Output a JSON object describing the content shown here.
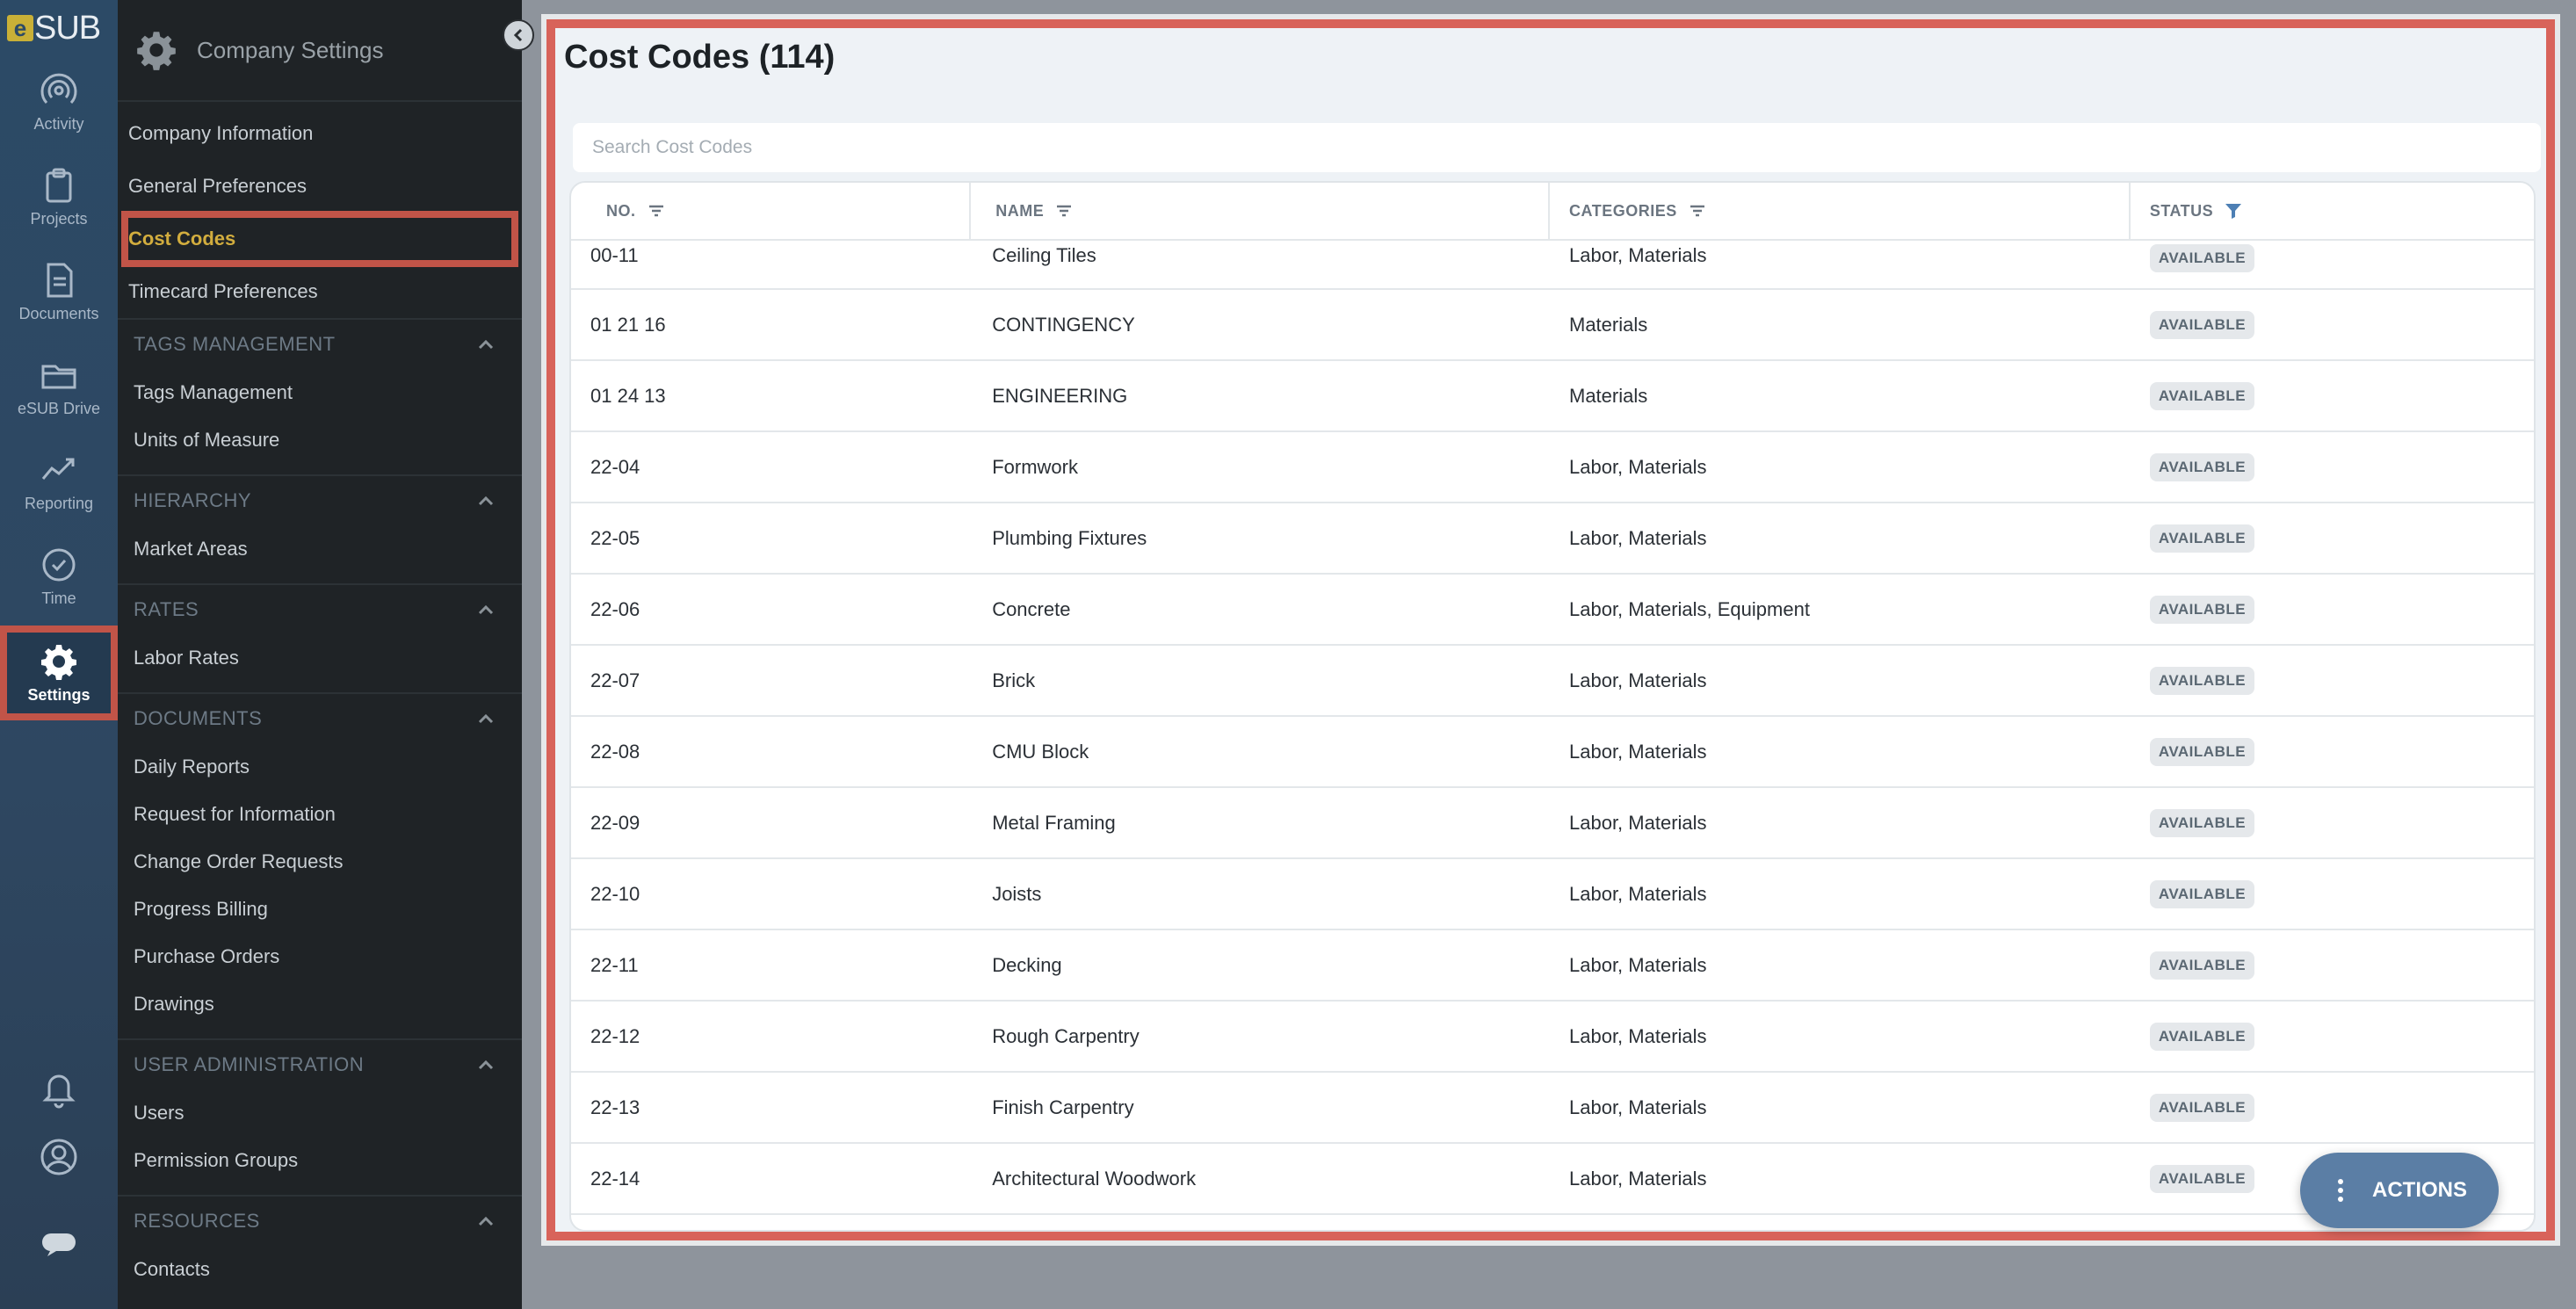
{
  "rail": {
    "logo_letter": "e",
    "logo_text": "SUB",
    "items": [
      {
        "label": "Activity",
        "icon": "activity-icon"
      },
      {
        "label": "Projects",
        "icon": "clipboard-icon"
      },
      {
        "label": "Documents",
        "icon": "document-icon"
      },
      {
        "label": "eSUB Drive",
        "icon": "folder-icon"
      },
      {
        "label": "Reporting",
        "icon": "chart-line-icon"
      },
      {
        "label": "Time",
        "icon": "clock-icon"
      },
      {
        "label": "Settings",
        "icon": "gear-icon",
        "active": true
      }
    ],
    "bottom_icons": [
      "bell-icon",
      "user-icon",
      "chat-icon"
    ]
  },
  "sidebar": {
    "title": "Company Settings",
    "top_items": [
      "Company Information",
      "General Preferences",
      "Cost Codes",
      "Timecard Preferences"
    ],
    "selected": "Cost Codes",
    "sections": [
      {
        "title": "TAGS MANAGEMENT",
        "items": [
          "Tags Management",
          "Units of Measure"
        ]
      },
      {
        "title": "HIERARCHY",
        "items": [
          "Market Areas"
        ]
      },
      {
        "title": "RATES",
        "items": [
          "Labor Rates"
        ]
      },
      {
        "title": "DOCUMENTS",
        "items": [
          "Daily Reports",
          "Request for Information",
          "Change Order Requests",
          "Progress Billing",
          "Purchase Orders",
          "Drawings"
        ]
      },
      {
        "title": "USER ADMINISTRATION",
        "items": [
          "Users",
          "Permission Groups"
        ]
      },
      {
        "title": "RESOURCES",
        "items": [
          "Contacts"
        ]
      }
    ]
  },
  "main": {
    "title": "Cost Codes (114)",
    "search_placeholder": "Search Cost Codes",
    "columns": [
      "NO.",
      "NAME",
      "CATEGORIES",
      "STATUS"
    ],
    "rows": [
      {
        "no": "00-11",
        "name": "Ceiling Tiles",
        "categories": "Labor, Materials",
        "status": "AVAILABLE"
      },
      {
        "no": "01 21 16",
        "name": "CONTINGENCY",
        "categories": "Materials",
        "status": "AVAILABLE"
      },
      {
        "no": "01 24 13",
        "name": "ENGINEERING",
        "categories": "Materials",
        "status": "AVAILABLE"
      },
      {
        "no": "22-04",
        "name": "Formwork",
        "categories": "Labor, Materials",
        "status": "AVAILABLE"
      },
      {
        "no": "22-05",
        "name": "Plumbing Fixtures",
        "categories": "Labor, Materials",
        "status": "AVAILABLE"
      },
      {
        "no": "22-06",
        "name": "Concrete",
        "categories": "Labor, Materials, Equipment",
        "status": "AVAILABLE"
      },
      {
        "no": "22-07",
        "name": "Brick",
        "categories": "Labor, Materials",
        "status": "AVAILABLE"
      },
      {
        "no": "22-08",
        "name": "CMU Block",
        "categories": "Labor, Materials",
        "status": "AVAILABLE"
      },
      {
        "no": "22-09",
        "name": "Metal Framing",
        "categories": "Labor, Materials",
        "status": "AVAILABLE"
      },
      {
        "no": "22-10",
        "name": "Joists",
        "categories": "Labor, Materials",
        "status": "AVAILABLE"
      },
      {
        "no": "22-11",
        "name": "Decking",
        "categories": "Labor, Materials",
        "status": "AVAILABLE"
      },
      {
        "no": "22-12",
        "name": "Rough Carpentry",
        "categories": "Labor, Materials",
        "status": "AVAILABLE"
      },
      {
        "no": "22-13",
        "name": "Finish Carpentry",
        "categories": "Labor, Materials",
        "status": "AVAILABLE"
      },
      {
        "no": "22-14",
        "name": "Architectural Woodwork",
        "categories": "Labor, Materials",
        "status": "AVAILABLE"
      }
    ],
    "actions_label": "ACTIONS"
  },
  "colors": {
    "rail_bg": "#2c4a66",
    "sidebar_bg": "#1f2326",
    "highlight_outline": "#c15448",
    "selected_text": "#d2ad3e",
    "actions_bg": "#5b7ea5"
  }
}
